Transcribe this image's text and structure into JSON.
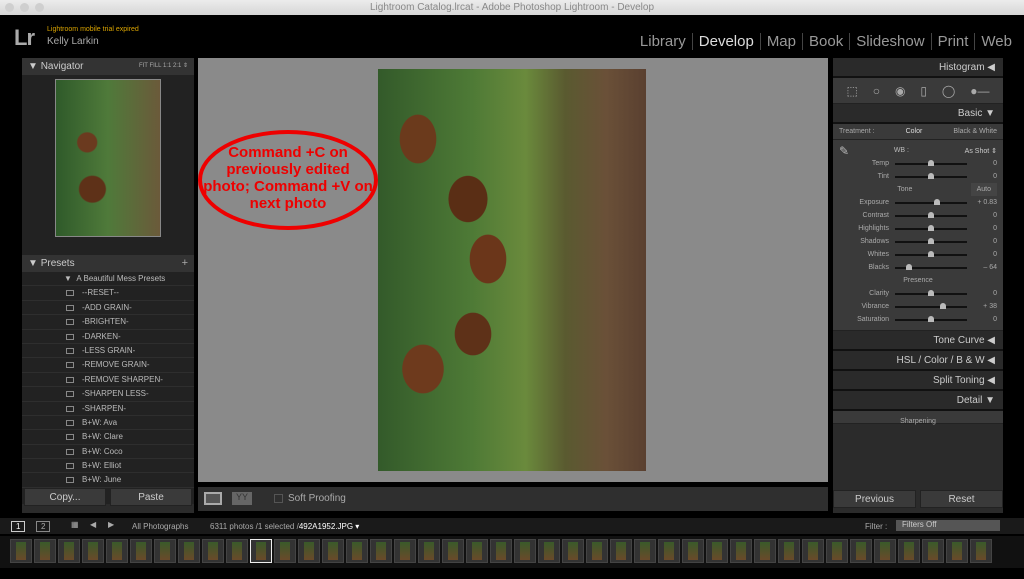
{
  "window": {
    "title": "Lightroom Catalog.lrcat - Adobe Photoshop Lightroom - Develop"
  },
  "identity": {
    "logo": "Lr",
    "notice": "Lightroom mobile trial expired",
    "user": "Kelly Larkin"
  },
  "modules": [
    "Library",
    "Develop",
    "Map",
    "Book",
    "Slideshow",
    "Print",
    "Web"
  ],
  "navigator": {
    "title": "Navigator",
    "zoom": "FIT   FILL   1:1   2:1 ⇕"
  },
  "presets": {
    "title": "Presets",
    "folder": "A Beautiful Mess Presets",
    "items": [
      "--RESET--",
      "-ADD GRAIN-",
      "-BRIGHTEN-",
      "-DARKEN-",
      "-LESS GRAIN-",
      "-REMOVE GRAIN-",
      "-REMOVE SHARPEN-",
      "-SHARPEN LESS-",
      "-SHARPEN-",
      "B+W: Ava",
      "B+W: Clare",
      "B+W: Coco",
      "B+W: Elliot",
      "B+W: June"
    ]
  },
  "left_buttons": {
    "copy": "Copy...",
    "paste": "Paste"
  },
  "annotation": "Command +C on previously edited photo; Command +V on next photo",
  "toolbar": {
    "soft_proofing": "Soft Proofing"
  },
  "right": {
    "histogram": "Histogram ◀",
    "basic": "Basic ▼",
    "treatment": "Treatment :",
    "color": "Color",
    "bw": "Black & White",
    "wb": "WB :",
    "wb_value": "As Shot ⇕",
    "tone": "Tone",
    "auto": "Auto",
    "presence": "Presence",
    "sliders": [
      {
        "label": "Temp",
        "value": "0",
        "pos": 0.5
      },
      {
        "label": "Tint",
        "value": "0",
        "pos": 0.5
      },
      {
        "label": "Exposure",
        "value": "+ 0.83",
        "pos": 0.58
      },
      {
        "label": "Contrast",
        "value": "0",
        "pos": 0.5
      },
      {
        "label": "Highlights",
        "value": "0",
        "pos": 0.5
      },
      {
        "label": "Shadows",
        "value": "0",
        "pos": 0.5
      },
      {
        "label": "Whites",
        "value": "0",
        "pos": 0.5
      },
      {
        "label": "Blacks",
        "value": "– 64",
        "pos": 0.2
      },
      {
        "label": "Clarity",
        "value": "0",
        "pos": 0.5
      },
      {
        "label": "Vibrance",
        "value": "+ 38",
        "pos": 0.67
      },
      {
        "label": "Saturation",
        "value": "0",
        "pos": 0.5
      }
    ],
    "tone_curve": "Tone Curve ◀",
    "hsl": "HSL / Color / B & W ◀",
    "split": "Split Toning ◀",
    "detail": "Detail ▼",
    "sharpening": "Sharpening",
    "previous": "Previous",
    "reset": "Reset"
  },
  "filmstrip": {
    "page1": "1",
    "page2": "2",
    "source": "All Photographs",
    "count": "6311 photos /1 selected /",
    "file": "492A1952.JPG ▾",
    "filter_label": "Filter :",
    "filter": "Filters Off"
  }
}
